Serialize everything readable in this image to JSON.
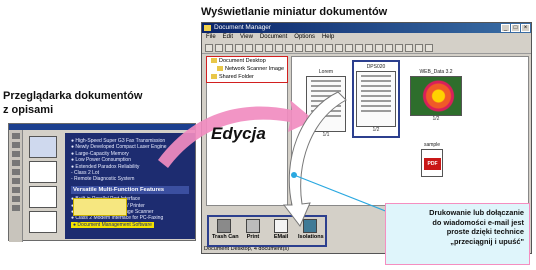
{
  "captions": {
    "top": "Wyświetlanie miniatur dokumentów",
    "left_line1": "Przeglądarka dokumentów",
    "left_line2": "z opisami"
  },
  "viewer": {
    "lines1": [
      "● High-Speed Super G3 Fax Transmission",
      "● Newly Developed Compact Laser Engine",
      "● Large-Capacity Memory",
      "● Low Power Consumption",
      "● Extended Paradox Reliability",
      "   - Class 2 Lot",
      "   - Remote Diagnostic System"
    ],
    "heading": "Versatile Multi-Function Features",
    "lines2": [
      "● Built-in Parallel Port Interface",
      "● 600 × 600 dpi Scanner / Printer",
      "● TWAIN-Compatible Image Scanner",
      "● Class 2 Modem Interface for PC-Faxing"
    ],
    "highlight": "● Document Management Software"
  },
  "window": {
    "title": "Document Manager",
    "menu": [
      "File",
      "Edit",
      "View",
      "Document",
      "Options",
      "Help"
    ],
    "tree": [
      "Document Desktop",
      "Network Scanner Image",
      "Shared Folder"
    ],
    "status": "Document Desktop, 4 document(s)"
  },
  "thumbs": [
    {
      "label": "Lorem",
      "nav": "1/1"
    },
    {
      "label": "DPS020",
      "nav": "1/2"
    },
    {
      "label": "WEB_Data 3.2",
      "nav": "1/2"
    },
    {
      "label": "sample",
      "nav": ""
    }
  ],
  "dropbar": [
    "Trash Can",
    "Print",
    "EMail",
    "Isolations"
  ],
  "annotations": {
    "edit": "Edycja",
    "callout": [
      "Drukowanie lub dołączanie",
      "do wiadomości e-mail jest",
      "proste dzięki technice",
      "„przeciągnij i upuść\""
    ]
  },
  "colors": {
    "pink_arrow": "#f18cc0",
    "callout_bg": "#dff5fb",
    "dot": "#2aa8e0"
  }
}
